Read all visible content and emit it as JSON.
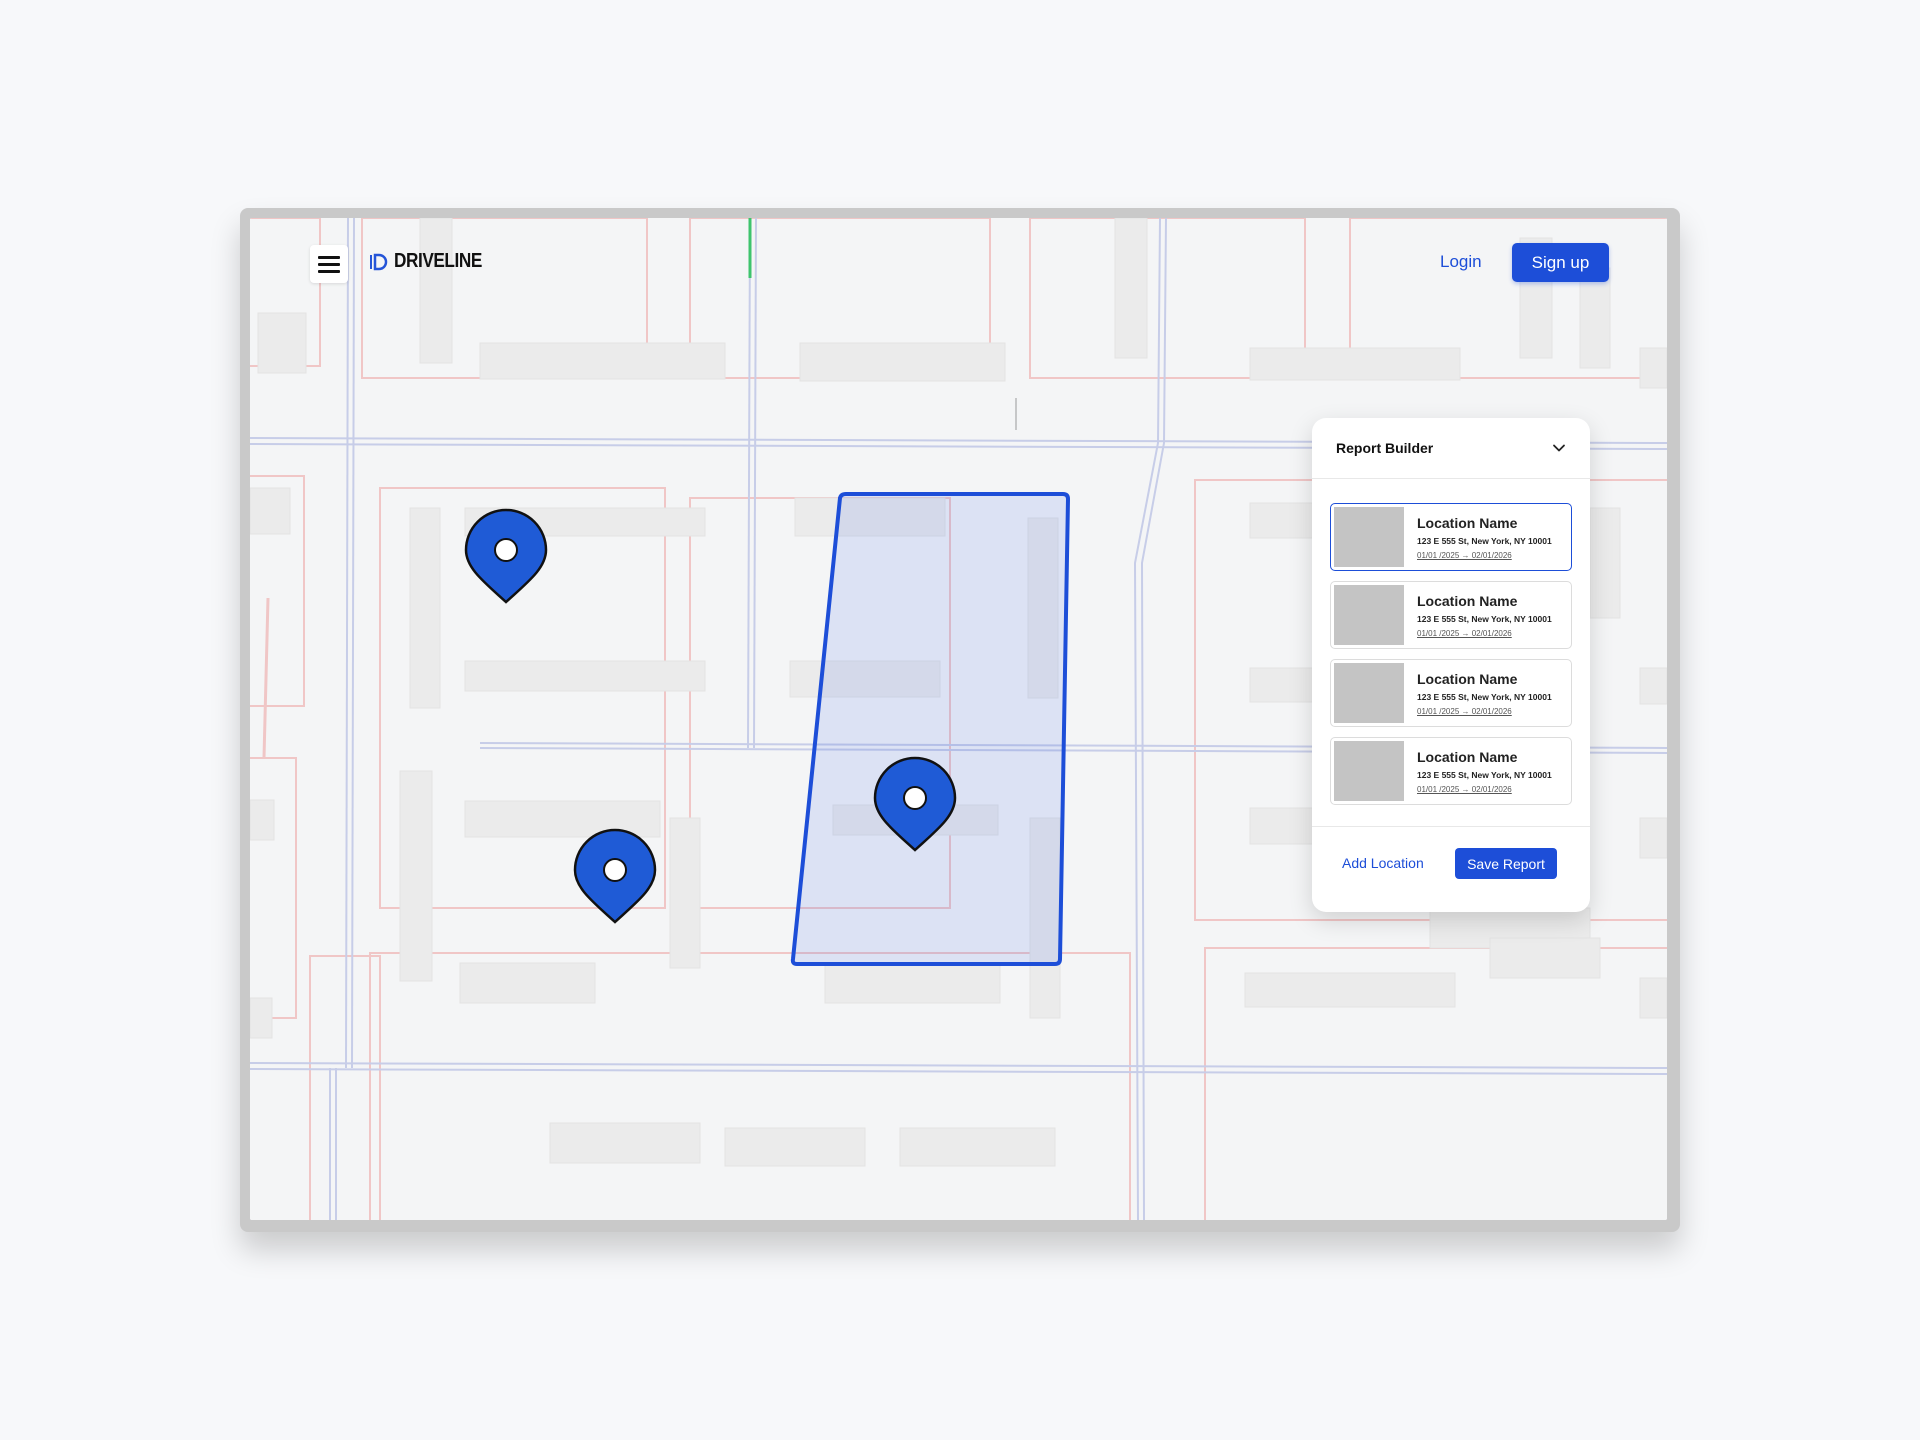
{
  "brand": {
    "name": "DRIVELINE",
    "accent": "#1d4ed8"
  },
  "header": {
    "login_label": "Login",
    "signup_label": "Sign up"
  },
  "map": {
    "pins": [
      {
        "label": "",
        "icon": "map-pin-icon"
      },
      {
        "label": "",
        "icon": "map-pin-icon"
      },
      {
        "label": "",
        "icon": "map-pin-icon"
      }
    ]
  },
  "report": {
    "title": "Report Builder",
    "items": [
      {
        "name": "Location Name",
        "address": "123 E 555 St, New York, NY 10001",
        "dates": "01/01 /2025 → 02/01/2026",
        "selected": true
      },
      {
        "name": "Location Name",
        "address": "123 E 555 St, New York, NY 10001",
        "dates": "01/01 /2025 → 02/01/2026",
        "selected": false
      },
      {
        "name": "Location Name",
        "address": "123 E 555 St, New York, NY 10001",
        "dates": "01/01 /2025 → 02/01/2026",
        "selected": false
      },
      {
        "name": "Location Name",
        "address": "123 E 555 St, New York, NY 10001",
        "dates": "01/01 /2025 → 02/01/2026",
        "selected": false
      }
    ],
    "add_label": "Add Location",
    "save_label": "Save Report"
  }
}
